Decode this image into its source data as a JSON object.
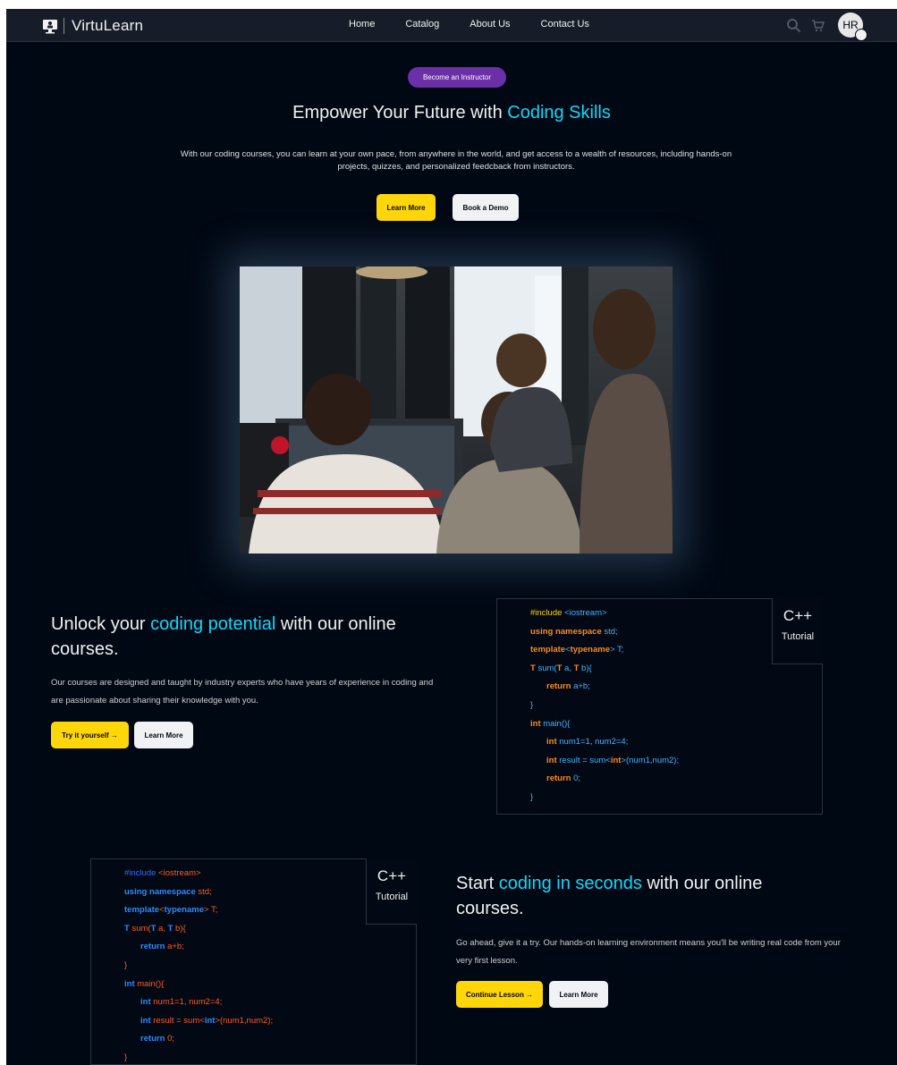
{
  "nav": {
    "brand": "VirtuLearn",
    "links": [
      "Home",
      "Catalog",
      "About Us",
      "Contact Us"
    ],
    "avatar_initials": "HR",
    "icons": [
      "search-icon",
      "cart-icon"
    ]
  },
  "hero": {
    "instructor_button": "Become an Instructor",
    "title_part1": "Empower Your Future with ",
    "title_highlight": "Coding Skills",
    "description": "With our coding courses, you can learn at your own pace, from anywhere in the world, and get access to a wealth of resources, including hands-on projects, quizzes, and personalized feedcback from instructors.",
    "learn_more": "Learn More",
    "book_demo": "Book a Demo"
  },
  "section1": {
    "title_part1": "Unlock your ",
    "title_highlight": "coding potential",
    "title_part2": " with our online courses.",
    "description": "Our courses are designed and taught by industry experts who have years of experience in coding and are passionate about sharing their knowledge with you.",
    "try_button": "Try it yourself →",
    "learn_more": "Learn More",
    "code_tag_lang": "C++",
    "code_tag_label": "Tutorial"
  },
  "section2": {
    "title_part1": "Start ",
    "title_highlight": "coding in seconds",
    "title_part2": " with our online courses.",
    "description": "Go ahead, give it a try. Our hands-on learning environment means you'll be writing real code from your very first lesson.",
    "continue_button": "Continue Lesson →",
    "learn_more": "Learn More",
    "code_tag_lang": "C++",
    "code_tag_label": "Tutorial"
  },
  "code": {
    "l1_a": "#include ",
    "l1_b": "<iostream>",
    "l2_a": "using namespace ",
    "l2_b": "std;",
    "l3_a": "template",
    "l3_b": "<",
    "l3_c": "typename",
    "l3_d": "> T;",
    "l4_a": "T ",
    "l4_b": "sum(",
    "l4_c": "T ",
    "l4_d": "a, ",
    "l4_e": "T ",
    "l4_f": "b){",
    "l5_a": "return ",
    "l5_b": "a+b;",
    "l6": "}",
    "l7_a": "int ",
    "l7_b": "main(){",
    "l8_a": "int ",
    "l8_b": "num1=1, num2=4;",
    "l9_a": "int ",
    "l9_b": "result = sum<",
    "l9_c": "int",
    "l9_d": ">(num1,num2);",
    "l10_a": "return ",
    "l10_b": "0;",
    "l11": "}"
  },
  "colors": {
    "background": "#000814",
    "accent_cyan": "#12d8fa",
    "button_yellow": "#ffd60a",
    "instructor_purple": "#6b2fa8"
  }
}
